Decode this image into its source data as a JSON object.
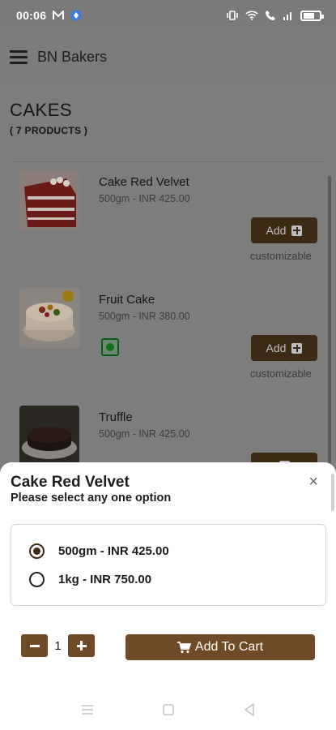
{
  "status_bar": {
    "time": "00:06"
  },
  "app_bar": {
    "title": "BN Bakers"
  },
  "category": {
    "title": "CAKES",
    "count": "( 7 PRODUCTS )"
  },
  "products": [
    {
      "name": "Cake Red Velvet",
      "desc": "500gm - INR 425.00",
      "add_label": "Add",
      "custom_label": "customizable"
    },
    {
      "name": "Fruit Cake",
      "desc": "500gm - INR 380.00",
      "add_label": "Add",
      "custom_label": "customizable"
    },
    {
      "name": "Truffle",
      "desc": "500gm - INR 425.00"
    }
  ],
  "sheet": {
    "title": "Cake Red Velvet",
    "subtitle": "Please select any one option",
    "close": "×",
    "options": [
      {
        "label": "500gm - INR 425.00",
        "selected": true
      },
      {
        "label": "1kg - INR 750.00",
        "selected": false
      }
    ],
    "quantity": "1",
    "add_to_cart": "Add To Cart"
  },
  "colors": {
    "brand_brown": "#6e4a26",
    "dark_brown": "#3d2a15",
    "veg_green": "#0f6d20"
  }
}
